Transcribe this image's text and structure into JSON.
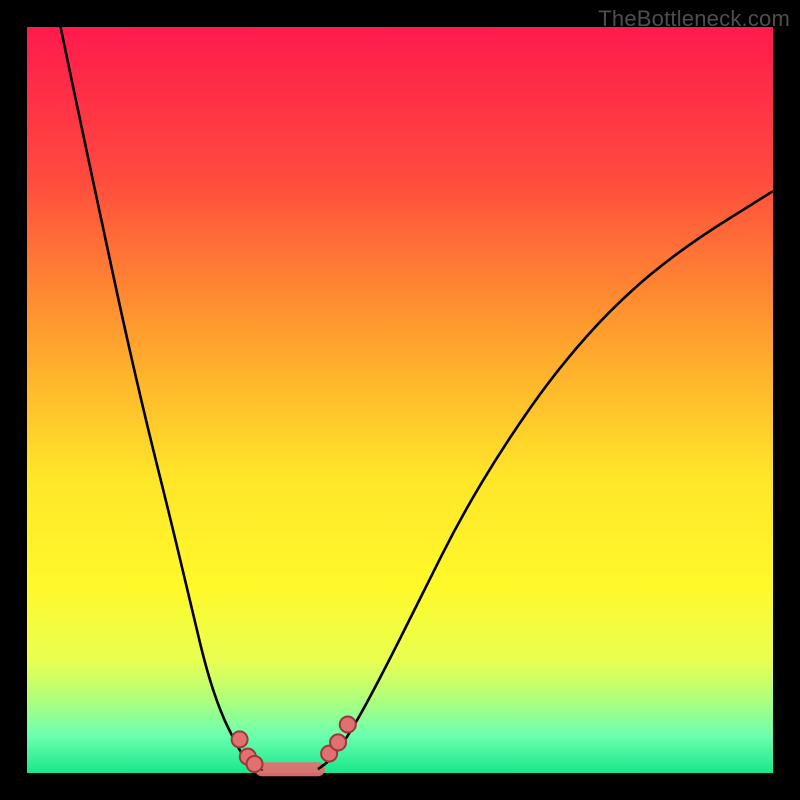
{
  "watermark": "TheBottleneck.com",
  "colors": {
    "gradient_top": "#ff1a4d",
    "gradient_bottom": "#17e88a",
    "curve_stroke": "#000000",
    "marker_fill": "#e17070",
    "marker_stroke": "#9c3838"
  },
  "chart_data": {
    "type": "line",
    "title": "",
    "xlabel": "",
    "ylabel": "",
    "xlim": [
      0,
      100
    ],
    "ylim": [
      0,
      100
    ],
    "series": [
      {
        "name": "left-curve",
        "x": [
          4.5,
          7,
          10,
          13,
          16,
          19,
          22,
          24,
          26,
          28,
          29,
          30.5,
          31.5
        ],
        "y": [
          100,
          88,
          74,
          60,
          47,
          35,
          22.5,
          14,
          8,
          4,
          2.2,
          1,
          0.5
        ]
      },
      {
        "name": "right-curve",
        "x": [
          39,
          41,
          44,
          48,
          53,
          58,
          64,
          71,
          79,
          88,
          100
        ],
        "y": [
          0.5,
          2,
          6.5,
          14,
          24,
          34,
          44,
          54,
          63,
          70.5,
          78
        ]
      }
    ],
    "bottom_band_segments": [
      {
        "x1": 31.5,
        "y1": 0.5,
        "x2": 39,
        "y2": 0.5
      }
    ],
    "markers": [
      {
        "x": 28.5,
        "y": 4.5
      },
      {
        "x": 29.6,
        "y": 2.2
      },
      {
        "x": 30.5,
        "y": 1.2
      },
      {
        "x": 40.5,
        "y": 2.6
      },
      {
        "x": 41.7,
        "y": 4.1
      },
      {
        "x": 43.0,
        "y": 6.5
      }
    ]
  }
}
